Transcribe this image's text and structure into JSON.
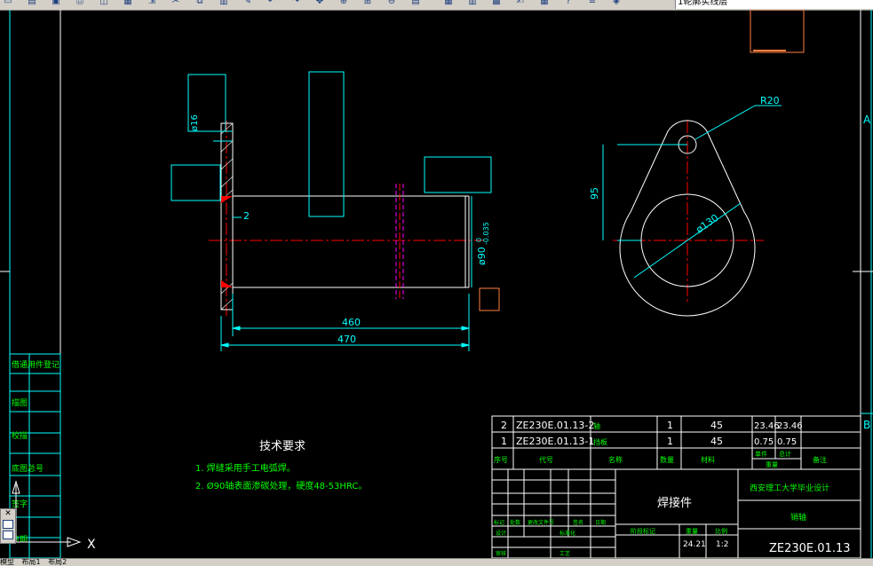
{
  "toolbar": {
    "icons": [
      "new-icon",
      "open-icon",
      "save-icon",
      "print-icon",
      "preview-icon",
      "publish-icon",
      "plot-icon",
      "cut-icon",
      "copy-icon",
      "paste-icon",
      "match-icon",
      "undo-icon",
      "redo-icon",
      "pan-icon",
      "zoom-realtime-icon",
      "zoom-window-icon",
      "zoom-previous-icon",
      "properties-icon",
      "designcenter-icon",
      "toolpalette-icon",
      "sheetset-icon",
      "markup-icon",
      "calc-icon",
      "help-icon",
      "layer-manager-icon",
      "layer-state-icon"
    ],
    "layer_name": "1轮廓实线层"
  },
  "drawing": {
    "dim_phi16": "ø16",
    "dim_2": "2",
    "dim_phi90": "ø90",
    "tol_upper": "0",
    "tol_lower": "-0.035",
    "dim_460": "460",
    "dim_470": "470",
    "dim_R20": "R20",
    "dim_95": "95",
    "dim_phi130": "ø130",
    "zone_a": "A",
    "zone_b": "B",
    "left_labels": [
      "借通用件登记",
      "描图",
      "校描",
      "底图总号",
      "签字",
      "日期"
    ],
    "tech_title": "技术要求",
    "tech_items": [
      "1. 焊缝采用手工电弧焊。",
      "2. Ø90轴表面渗碳处理，硬度48-53HRC。"
    ]
  },
  "bom": {
    "rows": [
      {
        "no": "2",
        "code": "ZE230E.01.13-2",
        "name": "轴",
        "qty": "1",
        "mat": "45",
        "unit": "23.46",
        "total": "23.46"
      },
      {
        "no": "1",
        "code": "ZE230E.01.13-1",
        "name": "挡板",
        "qty": "1",
        "mat": "45",
        "unit": "0.75",
        "total": "0.75"
      }
    ],
    "headers": {
      "no": "序号",
      "code": "代号",
      "name": "名称",
      "qty": "数量",
      "mat": "材料",
      "unit_top": "单件",
      "total_top": "总计",
      "weight": "重量",
      "remark": "备注"
    }
  },
  "title_block": {
    "part_type": "焊接件",
    "school": "西安理工大学毕业设计",
    "part_name": "销轴",
    "drawing_no": "ZE230E.01.13",
    "scale_hdr": "比例",
    "weight_hdr": "重量",
    "weight": "24.21",
    "scale": "1:2",
    "stage_hdr": "阶段标记",
    "small_labels": [
      "标记",
      "处数",
      "更改文件号",
      "签名",
      "日期",
      "设计",
      "标准化",
      "审核",
      "工艺",
      "批准"
    ]
  },
  "status": {
    "items": [
      "模型",
      "布局1",
      "布局2"
    ]
  },
  "colors": {
    "outline": "#ffffff",
    "dim": "#00ffff",
    "center": "#ff0000",
    "text": "#ffffff",
    "green_text": "#00ff00",
    "magenta": "#ff00ff",
    "orange": "#ff8040"
  }
}
